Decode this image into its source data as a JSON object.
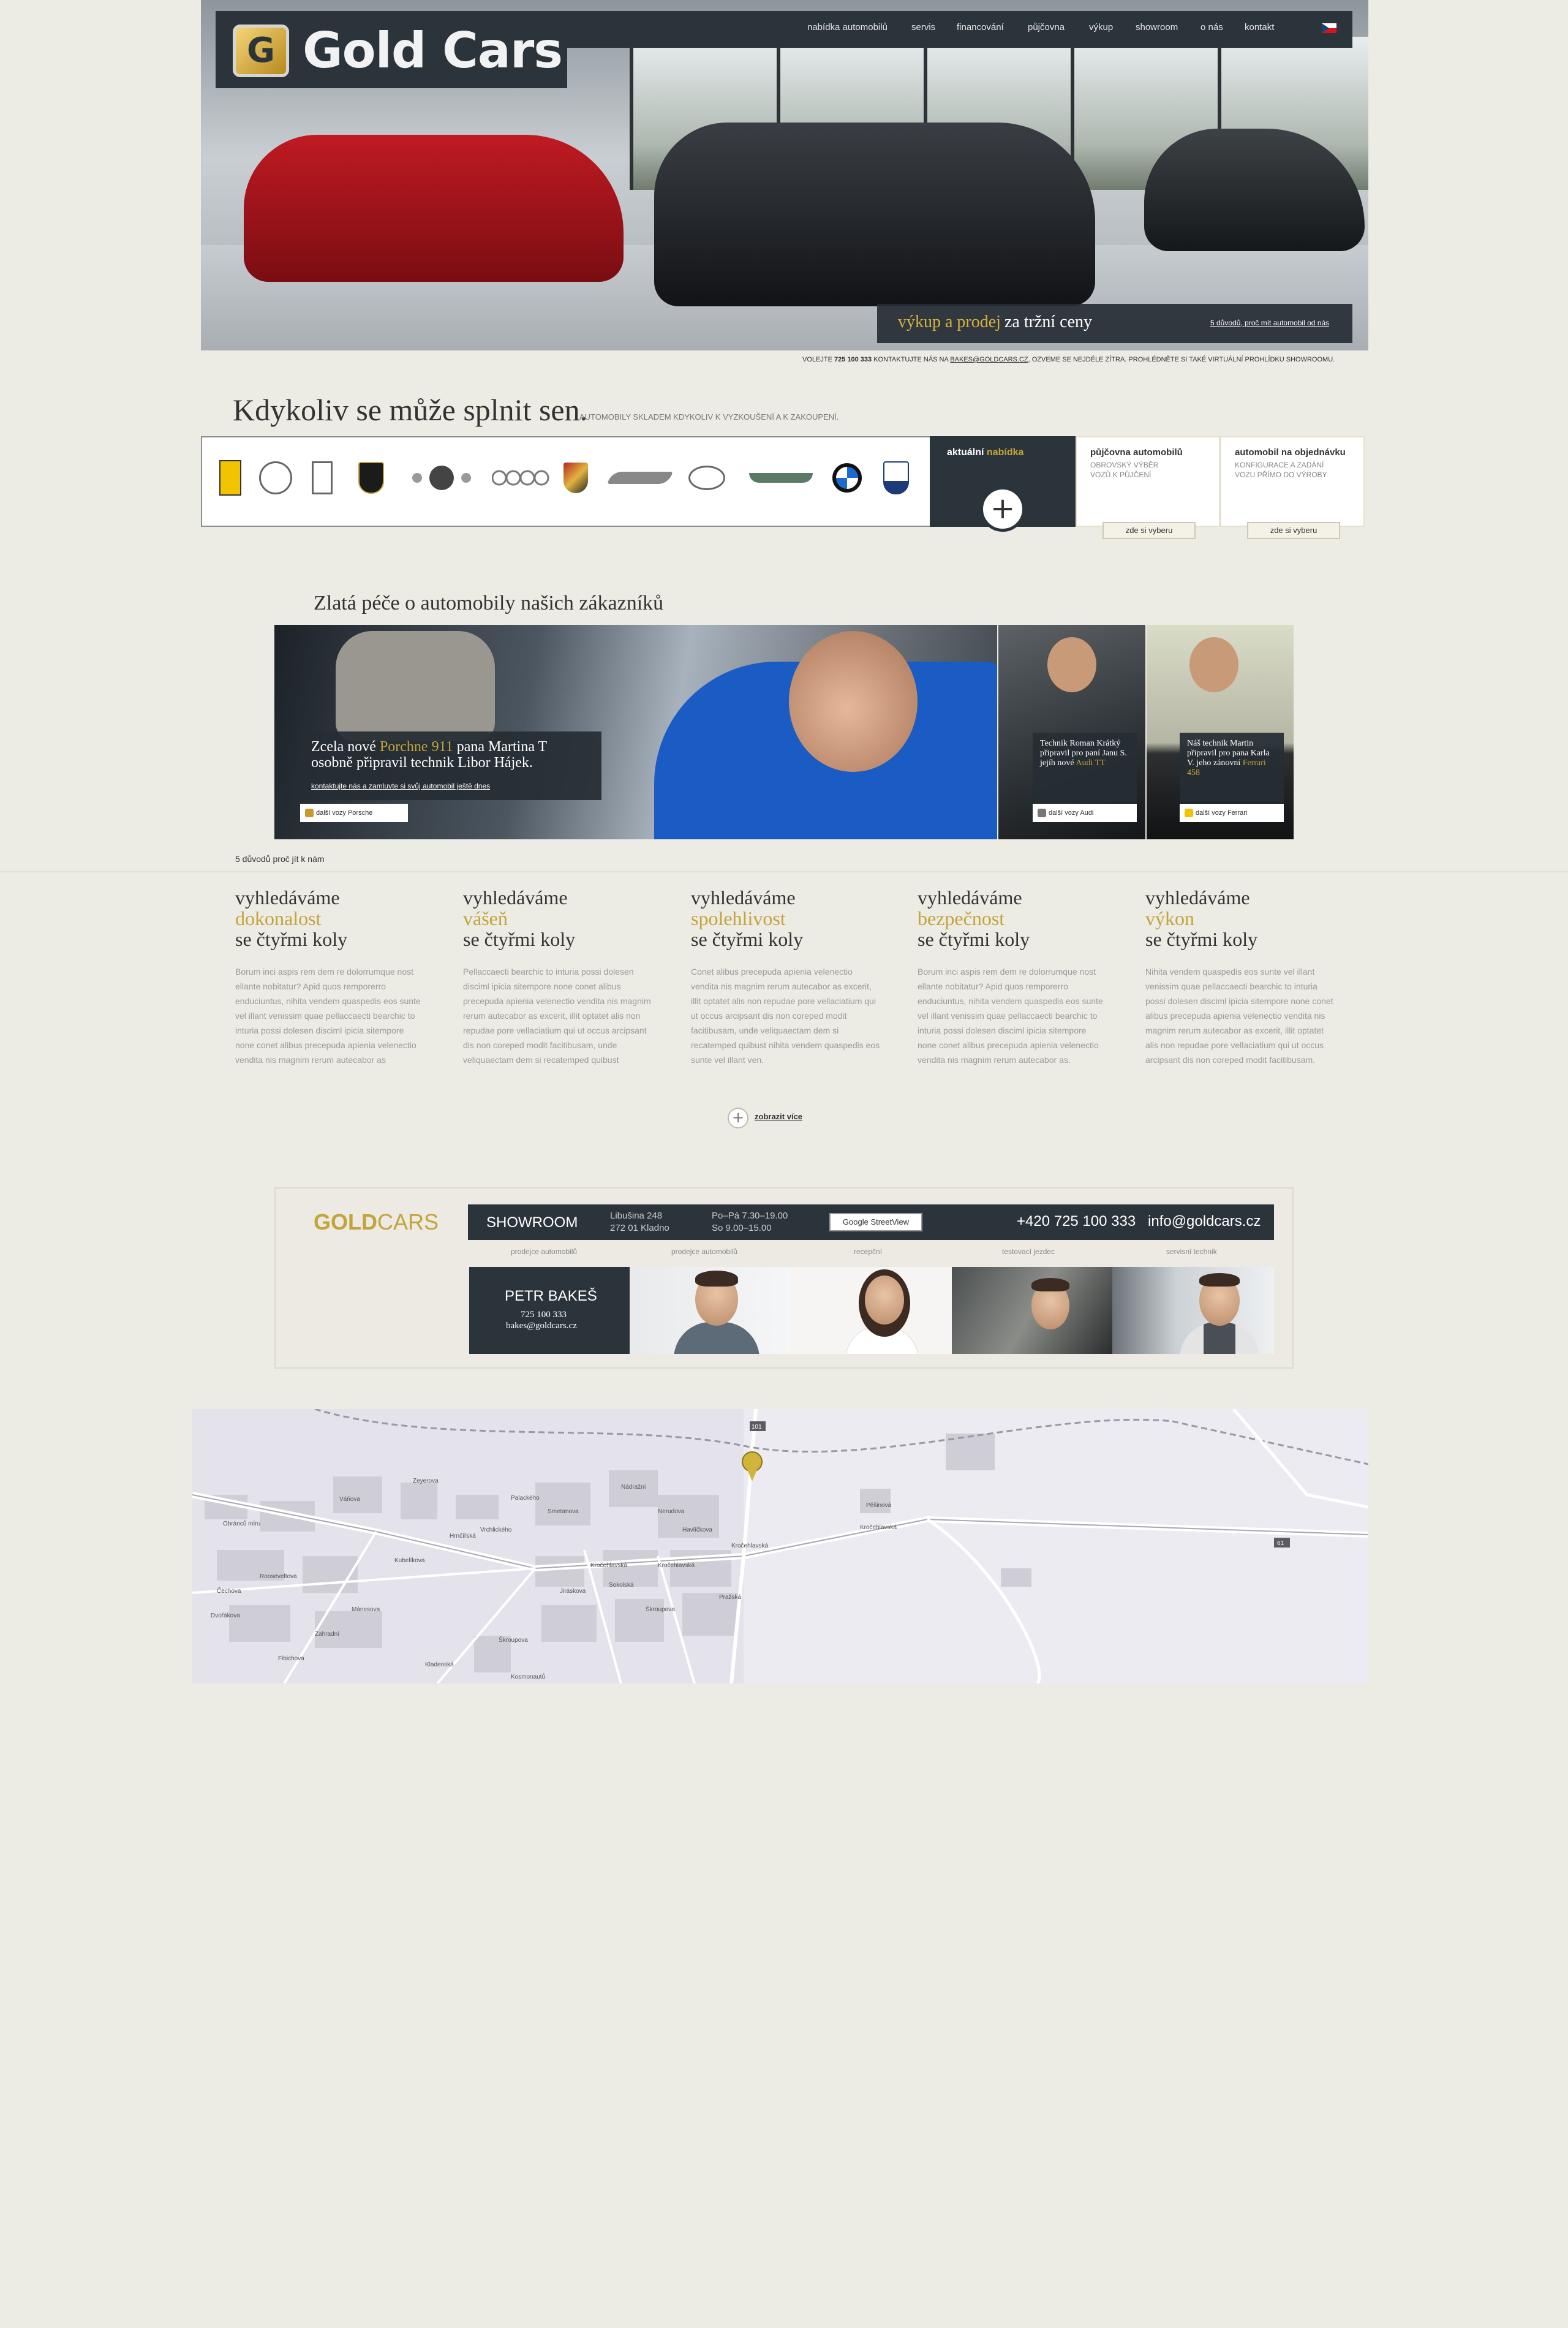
{
  "brand": {
    "name": "Gold Cars",
    "badge": "G"
  },
  "nav": [
    "nabídka automobilů",
    "servis",
    "financování",
    "půjčovna",
    "výkup",
    "showroom",
    "o nás",
    "kontakt"
  ],
  "promo": {
    "highlight": "výkup a prodej",
    "rest": "za tržní ceny",
    "link": "5 důvodů, proč mít automobil od nás"
  },
  "contact_line": "VOLEJTE 725 100 333 KONTAKTUJTE NÁS NA BAKES@GOLDCARS.CZ, OZVEME SE NEJDÉLE ZÍTRA. PROHLÉDNĚTE SI TAKÉ VIRTUÁLNÍ PROHLÍDKU SHOWROOMU.",
  "headline": {
    "title": "Kdykoliv se může splnit sen.",
    "subtitle": "AUTOMOBILY SKLADEM KDYKOLIV K VYZKOUŠENÍ A K ZAKOUPENÍ."
  },
  "brand_logos": [
    "ferrari-icon",
    "mercedes-icon",
    "rolls-royce-icon",
    "lamborghini-icon",
    "bentley-icon",
    "audi-icon",
    "porsche-icon",
    "jaguar-icon",
    "lexus-icon",
    "aston-martin-icon",
    "bmw-icon",
    "maserati-icon"
  ],
  "offers": {
    "aktualni": {
      "label_a": "aktuální",
      "label_b": "nabídka"
    },
    "pujcovna": {
      "title": "půjčovna automobilů",
      "desc1": "OBROVSKÝ VÝBĚR",
      "desc2": "VOZŮ K PŮJČENÍ",
      "button": "zde si vyberu"
    },
    "objednavka": {
      "title": "automobil na objednávku",
      "desc1": "KONFIGURACE A ZADÁNÍ",
      "desc2": "VOZU PŘÍMO DO VÝROBY",
      "button": "zde si vyberu"
    }
  },
  "care": {
    "title": "Zlatá péče o automobily našich zákazníků",
    "main": {
      "line1a": "Zcela nové",
      "line1b": "Porchne 911",
      "line1c": "pana Martina T",
      "line2": "osobně připravil technik Libor Hájek.",
      "link": "kontaktujte nás a zamluvte si svůj automobil ještě dnes",
      "foot": "další vozy Porsche"
    },
    "side1": {
      "text": "Technik Roman Krátký připravil pro paní Janu S. jejíh nové",
      "highlight": "Audi TT",
      "foot": "další vozy Audi"
    },
    "side2": {
      "text": "Náš technik Martin připravil pro pana Karla V. jeho zánovní",
      "highlight": "Ferrari 458",
      "foot": "další vozy Ferrari"
    }
  },
  "reasons": {
    "label": "5 důvodů proč jít k nám",
    "items": [
      {
        "h1": "vyhledáváme",
        "h2": "dokonalost",
        "h3": "se čtyřmi koly",
        "text": "Borum inci aspis rem dem re dolorrumque nost ellante nobitatur? Apid quos remporerro enduciuntus, nihita vendem quaspedis eos sunte vel illant venissim quae pellaccaecti bearchic to inturia possi dolesen disciml ipicia sitempore none conet alibus precepuda apienia velenectio vendita nis magnim rerum autecabor as"
      },
      {
        "h1": "vyhledáváme",
        "h2": "vášeň",
        "h3": "se čtyřmi koly",
        "text": "Pellaccaecti bearchic to inturia possi dolesen disciml ipicia sitempore none conet alibus precepuda apienia velenectio vendita nis magnim rerum autecabor as excerit, illit optatet alis non repudae pore vellaciatium qui ut occus arcipsant dis non coreped modit facitibusam, unde veliquaectam dem si recatemped quibust"
      },
      {
        "h1": "vyhledáváme",
        "h2": "spolehlivost",
        "h3": "se čtyřmi koly",
        "text": "Conet alibus precepuda apienia velenectio vendita nis magnim rerum autecabor as excerit, illit optatet alis non repudae pore vellaciatium qui ut occus arcipsant dis non coreped modit facitibusam, unde veliquaectam dem si recatemped quibust nihita vendem quaspedis eos sunte vel illant ven."
      },
      {
        "h1": "vyhledáváme",
        "h2": "bezpečnost",
        "h3": "se čtyřmi koly",
        "text": "Borum inci aspis rem dem re dolorrumque nost ellante nobitatur? Apid quos remporerro enduciuntus, nihita vendem quaspedis eos sunte vel illant venissim quae pellaccaecti bearchic to inturia possi dolesen disciml ipicia sitempore none conet alibus precepuda apienia velenectio vendita nis magnim rerum autecabor as."
      },
      {
        "h1": "vyhledáváme",
        "h2": "výkon",
        "h3": "se čtyřmi koly",
        "text": "Nihita vendem quaspedis eos sunte vel illant venissim quae pellaccaecti bearchic to inturia possi dolesen disciml ipicia sitempore none conet alibus precepuda apienia velenectio vendita nis magnim rerum autecabor as excerit, illit optatet alis non repudae pore vellaciatium qui ut occus arcipsant dis non coreped modit facitibusam."
      }
    ],
    "more": "zobrazit více"
  },
  "showroom": {
    "logo_a": "GOLD",
    "logo_b": "CARS",
    "label": "SHOWROOM",
    "addr1": "Libušina 248",
    "addr2": "272 01  Kladno",
    "hours1": "Po–Pá 7.30–19.00",
    "hours2": "So 9.00–15.00",
    "streetview": "Google StreetView",
    "phone": "+420 725 100 333",
    "email": "info@goldcars.cz",
    "roles": [
      "prodejce automobilů",
      "prodejce automobilů",
      "recepční",
      "testovací jezdec",
      "servisní technik"
    ],
    "card": {
      "name": "PETR BAKEŠ",
      "phone": "725 100 333",
      "email": "bakes@goldcars.cz"
    }
  },
  "map": {
    "streets": [
      "Palackého",
      "Hrnčířská",
      "Kročehlavská",
      "Kročehlavská",
      "Kročehlavská",
      "Čechova",
      "Rooseveltova",
      "Zahradní",
      "Škroupova",
      "Nádražní",
      "Obránců míru",
      "Váňova",
      "Kubelíkova",
      "Smetanova",
      "Pražská",
      "Dvořákova",
      "Fibichova",
      "Sokolská",
      "Zeyerova",
      "Mánesova",
      "Kročehlavská",
      "Kosmonautů",
      "Kladenská",
      "Vrchlického",
      "Havlíčkova",
      "Škroupova",
      "Pěšinová",
      "Jiráskova",
      "Nerudova"
    ],
    "road_badges": [
      "101",
      "61"
    ]
  },
  "colors": {
    "dark": "#2c343b",
    "gold": "#c3a43b",
    "bg": "#ecebe4"
  }
}
